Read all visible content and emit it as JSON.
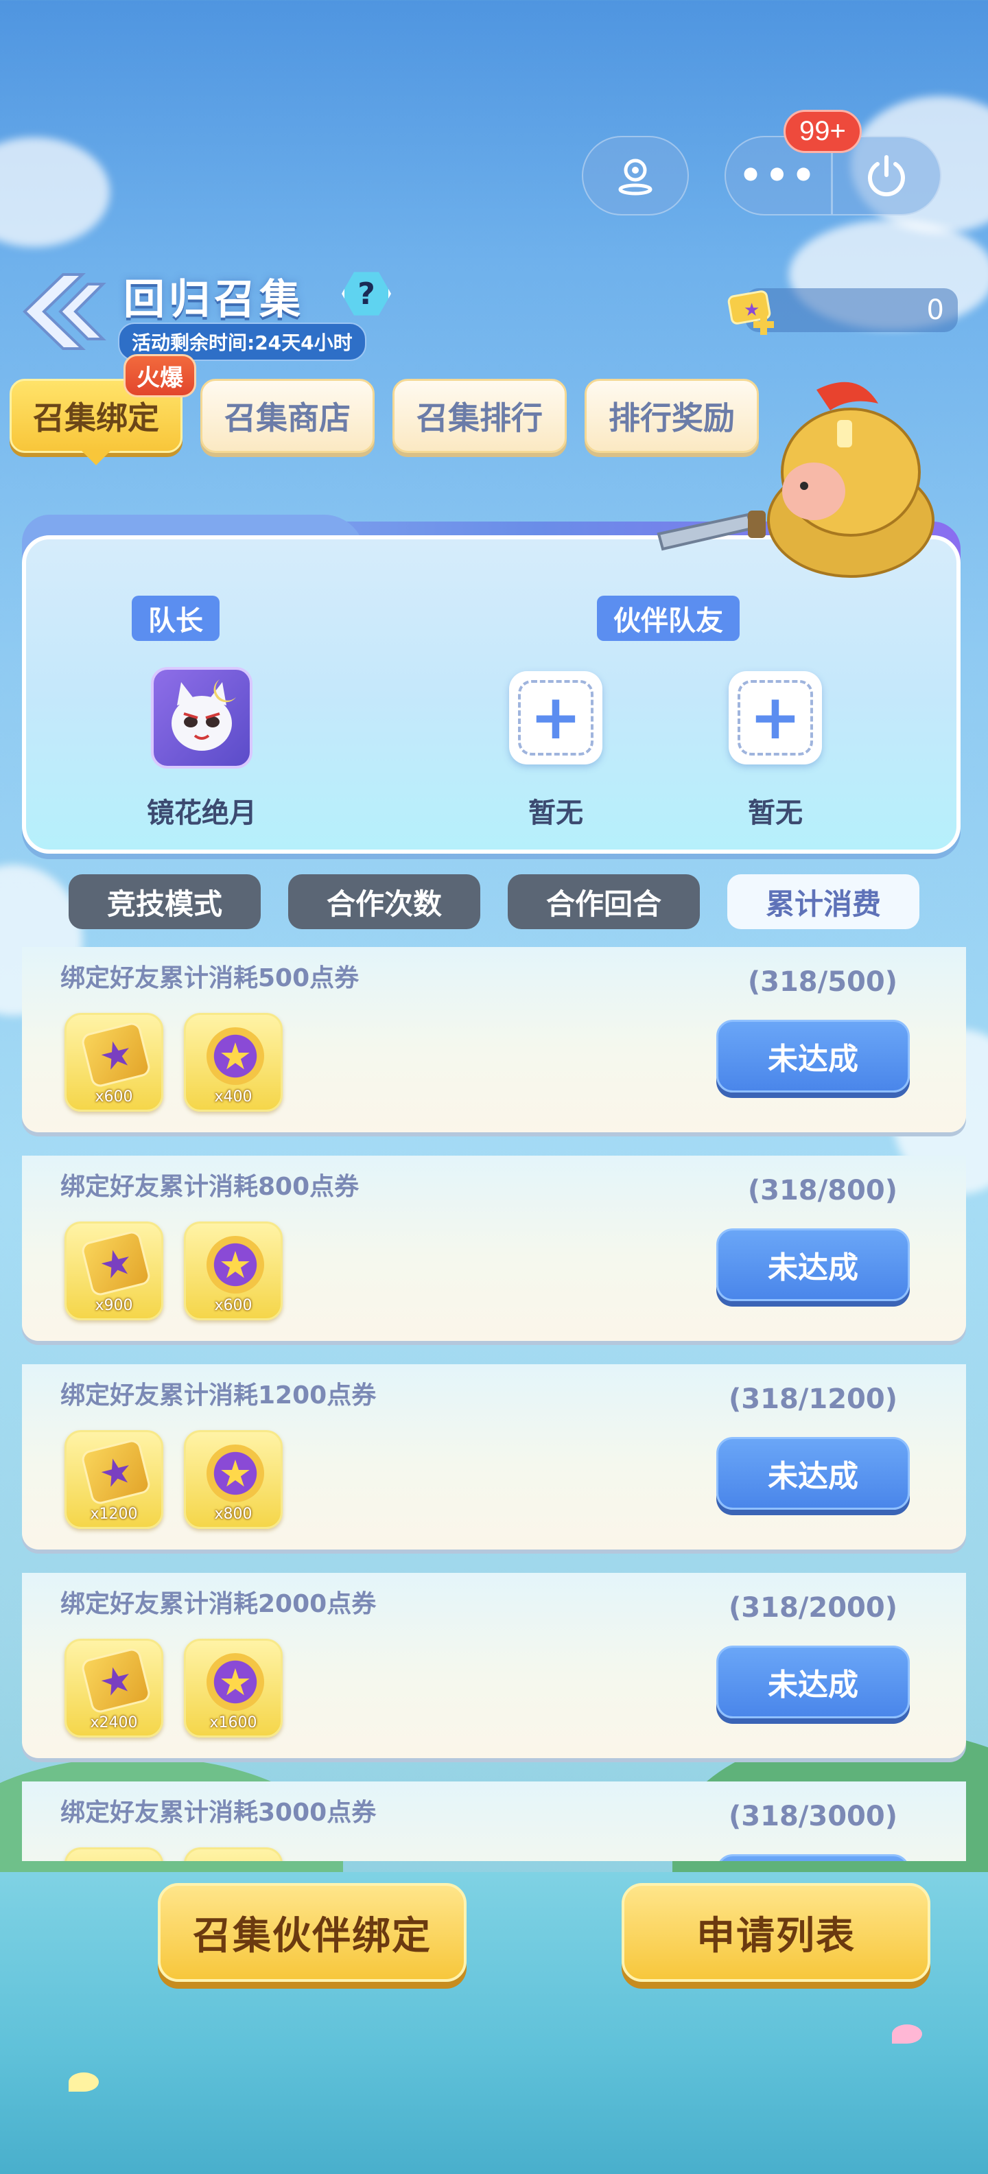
{
  "header": {
    "title": "回归召集",
    "timer": "活动剩余时间:24天4小时",
    "help": "?",
    "currency_value": "0",
    "notification_badge": "99+"
  },
  "top_tabs": [
    {
      "label": "召集绑定",
      "active": true,
      "badge": "火爆"
    },
    {
      "label": "召集商店",
      "active": false
    },
    {
      "label": "召集排行",
      "active": false
    },
    {
      "label": "排行奖励",
      "active": false
    }
  ],
  "team": {
    "captain_label": "队长",
    "partner_label": "伙伴队友",
    "captain_name": "镜花绝月",
    "slot1_name": "暂无",
    "slot2_name": "暂无"
  },
  "filter_tabs": [
    {
      "label": "竞技模式",
      "active": false
    },
    {
      "label": "合作次数",
      "active": false
    },
    {
      "label": "合作回合",
      "active": false
    },
    {
      "label": "累计消费",
      "active": true
    }
  ],
  "rewards": [
    {
      "title": "绑定好友累计消耗500点券",
      "progress": "(318/500)",
      "items": [
        {
          "icon": "ticket-icon",
          "qty": "x600"
        },
        {
          "icon": "star-coin-icon",
          "qty": "x400"
        }
      ],
      "button": "未达成"
    },
    {
      "title": "绑定好友累计消耗800点券",
      "progress": "(318/800)",
      "items": [
        {
          "icon": "ticket-icon",
          "qty": "x900"
        },
        {
          "icon": "star-coin-icon",
          "qty": "x600"
        }
      ],
      "button": "未达成"
    },
    {
      "title": "绑定好友累计消耗1200点券",
      "progress": "(318/1200)",
      "items": [
        {
          "icon": "ticket-icon",
          "qty": "x1200"
        },
        {
          "icon": "star-coin-icon",
          "qty": "x800"
        }
      ],
      "button": "未达成"
    },
    {
      "title": "绑定好友累计消耗2000点券",
      "progress": "(318/2000)",
      "items": [
        {
          "icon": "ticket-icon",
          "qty": "x2400"
        },
        {
          "icon": "star-coin-icon",
          "qty": "x1600"
        }
      ],
      "button": "未达成"
    },
    {
      "title": "绑定好友累计消耗3000点券",
      "progress": "(318/3000)",
      "items": [],
      "button": ""
    }
  ],
  "bottom_buttons": {
    "summon": "召集伙伴绑定",
    "applications": "申请列表"
  }
}
